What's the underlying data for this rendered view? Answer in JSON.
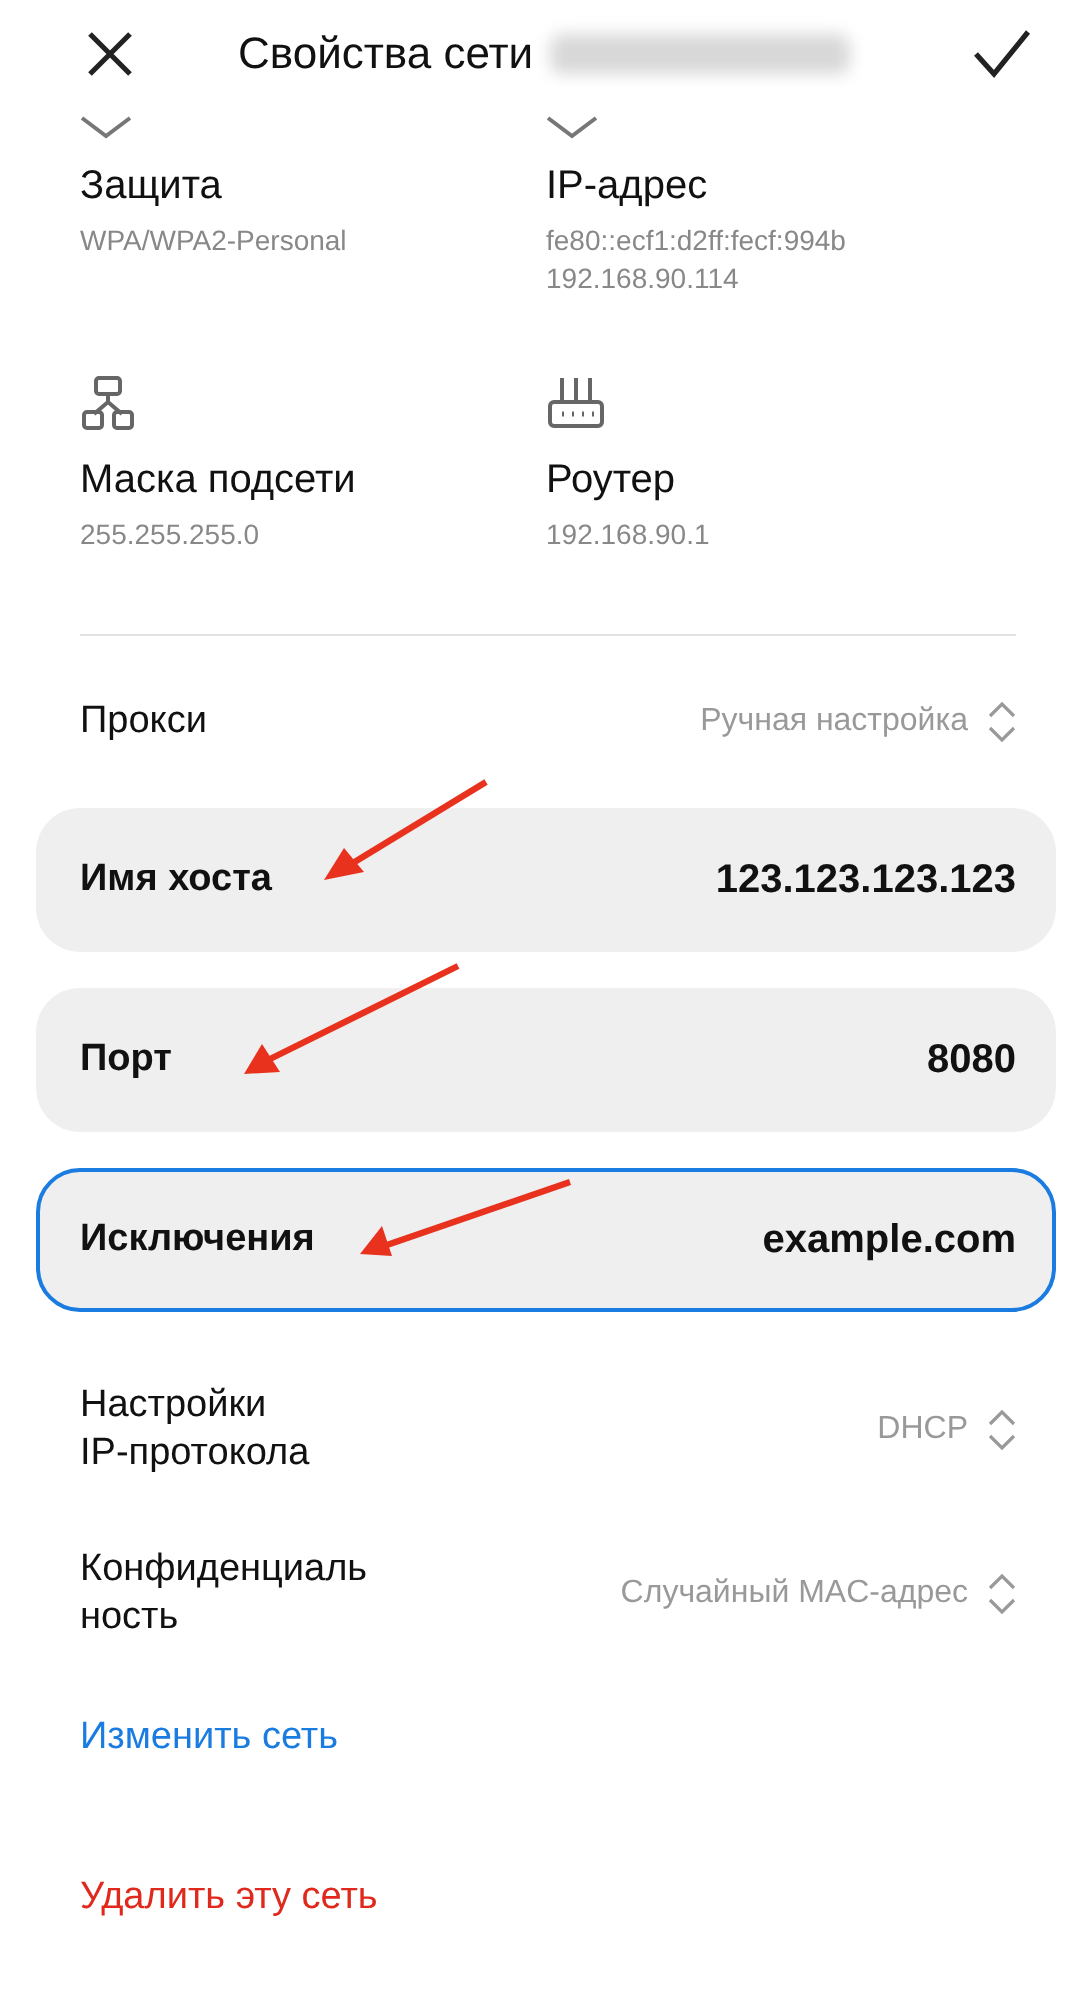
{
  "header": {
    "title": "Свойства сети"
  },
  "info": [
    {
      "label": "Защита",
      "values": [
        "WPA/WPA2-Personal"
      ]
    },
    {
      "label": "IP-адрес",
      "values": [
        "fe80::ecf1:d2ff:fecf:994b",
        "192.168.90.114"
      ]
    },
    {
      "label": "Маска подсети",
      "values": [
        "255.255.255.0"
      ]
    },
    {
      "label": "Роутер",
      "values": [
        "192.168.90.1"
      ]
    }
  ],
  "proxy": {
    "label": "Прокси",
    "value": "Ручная настройка"
  },
  "fields": [
    {
      "label": "Имя хоста",
      "value": "123.123.123.123",
      "focused": false
    },
    {
      "label": "Порт",
      "value": "8080",
      "focused": false
    },
    {
      "label": "Исключения",
      "value": "example.com",
      "focused": true
    }
  ],
  "settings": [
    {
      "label": "Настройки IP-протокола",
      "value": "DHCP"
    },
    {
      "label": "Конфиденциальность",
      "value": "Случайный MAC-адрес"
    }
  ],
  "links": [
    {
      "label": "Изменить сеть",
      "kind": "action"
    },
    {
      "label": "Удалить эту сеть",
      "kind": "danger"
    }
  ]
}
